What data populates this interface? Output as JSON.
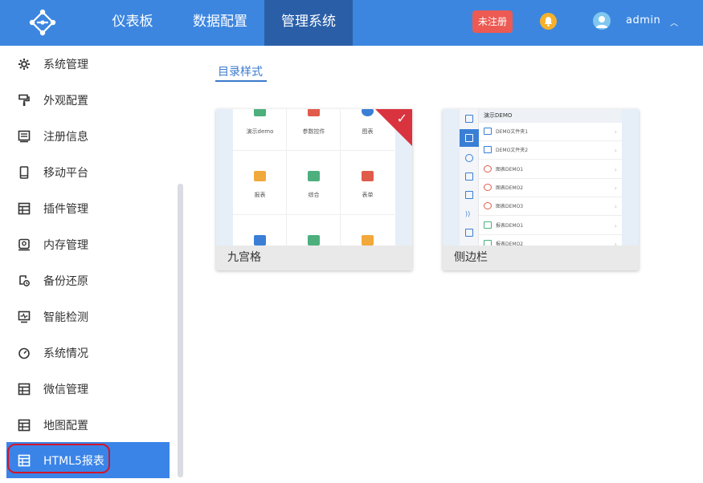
{
  "header": {
    "tabs": [
      {
        "label": "仪表板"
      },
      {
        "label": "数据配置"
      },
      {
        "label": "管理系统"
      }
    ],
    "unregistered_label": "未注册",
    "username": "admin",
    "colors": {
      "topbar": "#3c86e0",
      "active_tab": "#2a5fa8",
      "badge": "#ec5a53",
      "bell": "#f6b02a"
    }
  },
  "sidebar": {
    "items": [
      {
        "label": "系统管理",
        "icon": "gear-icon"
      },
      {
        "label": "外观配置",
        "icon": "paint-roller-icon"
      },
      {
        "label": "注册信息",
        "icon": "register-icon"
      },
      {
        "label": "移动平台",
        "icon": "mobile-icon"
      },
      {
        "label": "插件管理",
        "icon": "plugin-icon"
      },
      {
        "label": "内存管理",
        "icon": "memory-icon"
      },
      {
        "label": "备份还原",
        "icon": "backup-icon"
      },
      {
        "label": "智能检测",
        "icon": "monitor-icon"
      },
      {
        "label": "系统情况",
        "icon": "gauge-icon"
      },
      {
        "label": "微信管理",
        "icon": "wechat-icon"
      },
      {
        "label": "地图配置",
        "icon": "map-icon"
      },
      {
        "label": "HTML5报表",
        "icon": "html5-report-icon"
      }
    ],
    "active_index": 11
  },
  "main": {
    "section_title": "目录样式",
    "cards": [
      {
        "caption": "九宫格",
        "selected": true,
        "grid_labels": [
          "演示demo",
          "参数控件",
          "图表",
          "报表",
          "综合",
          "表单"
        ]
      },
      {
        "caption": "侧边栏",
        "selected": false,
        "header": "演示DEMO",
        "rows": [
          "DEMO文件夹1",
          "DEMO文件夹2",
          "图表DEMO1",
          "图表DEMO2",
          "图表DEMO3",
          "报表DEMO1",
          "报表DEMO2"
        ]
      }
    ]
  }
}
